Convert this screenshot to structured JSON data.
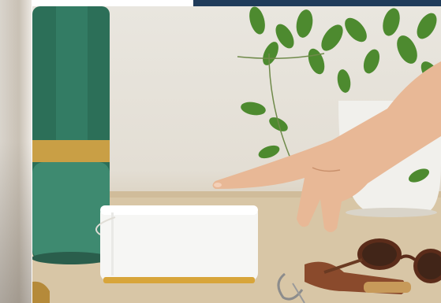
{
  "page": {
    "background": "#ffffff",
    "banner_color": "#1f3b5a"
  },
  "photo": {
    "subject_icons": [
      "vase-icon",
      "plant-icon",
      "smart-hub-icon",
      "hand-icon",
      "sunglasses-icon",
      "keychain-icon"
    ],
    "colors": {
      "wall": "#e6e2da",
      "table": "#d7c3a2",
      "vase_green": "#2f7a63",
      "vase_gold": "#caa24a",
      "hub_white": "#f6f6f4",
      "hub_base": "#d8a53a",
      "leaf": "#4f8a2e",
      "skin": "#e7b897",
      "sunglass_frame": "#6a3a22",
      "strap": "#8a4a2c"
    }
  }
}
